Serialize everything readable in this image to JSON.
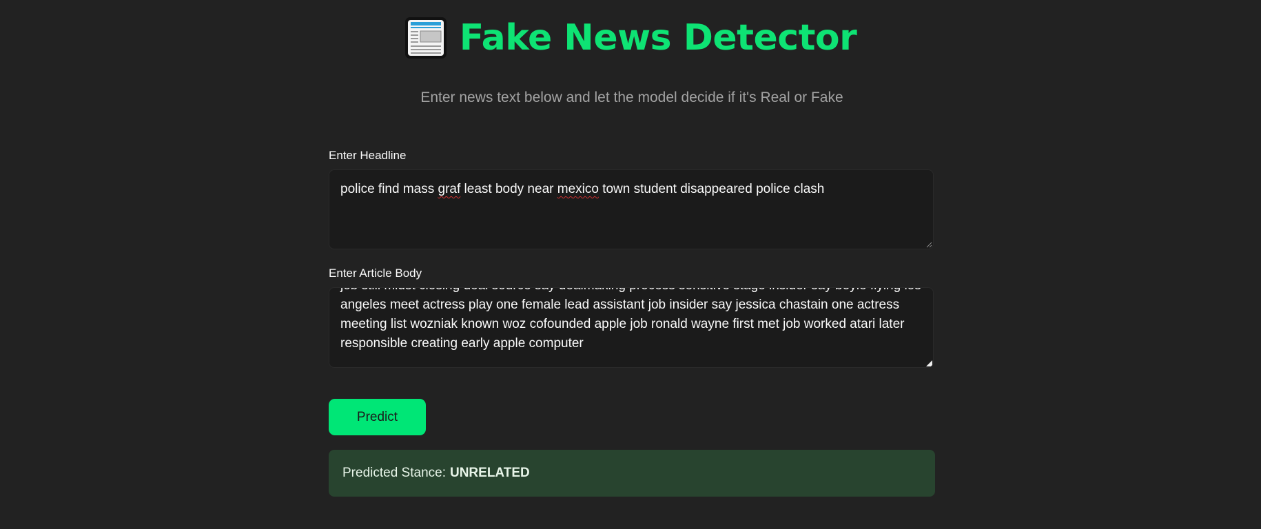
{
  "header": {
    "icon": "newspaper-icon",
    "title": "Fake News Detector",
    "subtitle": "Enter news text below and let the model decide if it's Real or Fake"
  },
  "headline": {
    "label": "Enter Headline",
    "value_before": "police find mass ",
    "value_misspelled_1": "graf",
    "value_middle": " least body near ",
    "value_misspelled_2": "mexico",
    "value_after": " town student disappeared police clash"
  },
  "article_body": {
    "label": "Enter Article Body",
    "visible_lines": [
      "job still midst closing deal source say dealmaking process sensitive stage insider say boyle flying los",
      "angeles meet actress play one female lead assistant job insider say jessica chastain one actress",
      "meeting list wozniak known woz cofounded apple job ronald wayne first met job worked atari later",
      "responsible creating early apple computer"
    ]
  },
  "predict_button": {
    "label": "Predict"
  },
  "result": {
    "prefix": "Predicted Stance:",
    "value": "UNRELATED"
  },
  "colors": {
    "background": "#222222",
    "accent": "#0ee374",
    "button": "#00e676",
    "result_bg": "#28442f",
    "subtitle": "#a3a3a3"
  }
}
